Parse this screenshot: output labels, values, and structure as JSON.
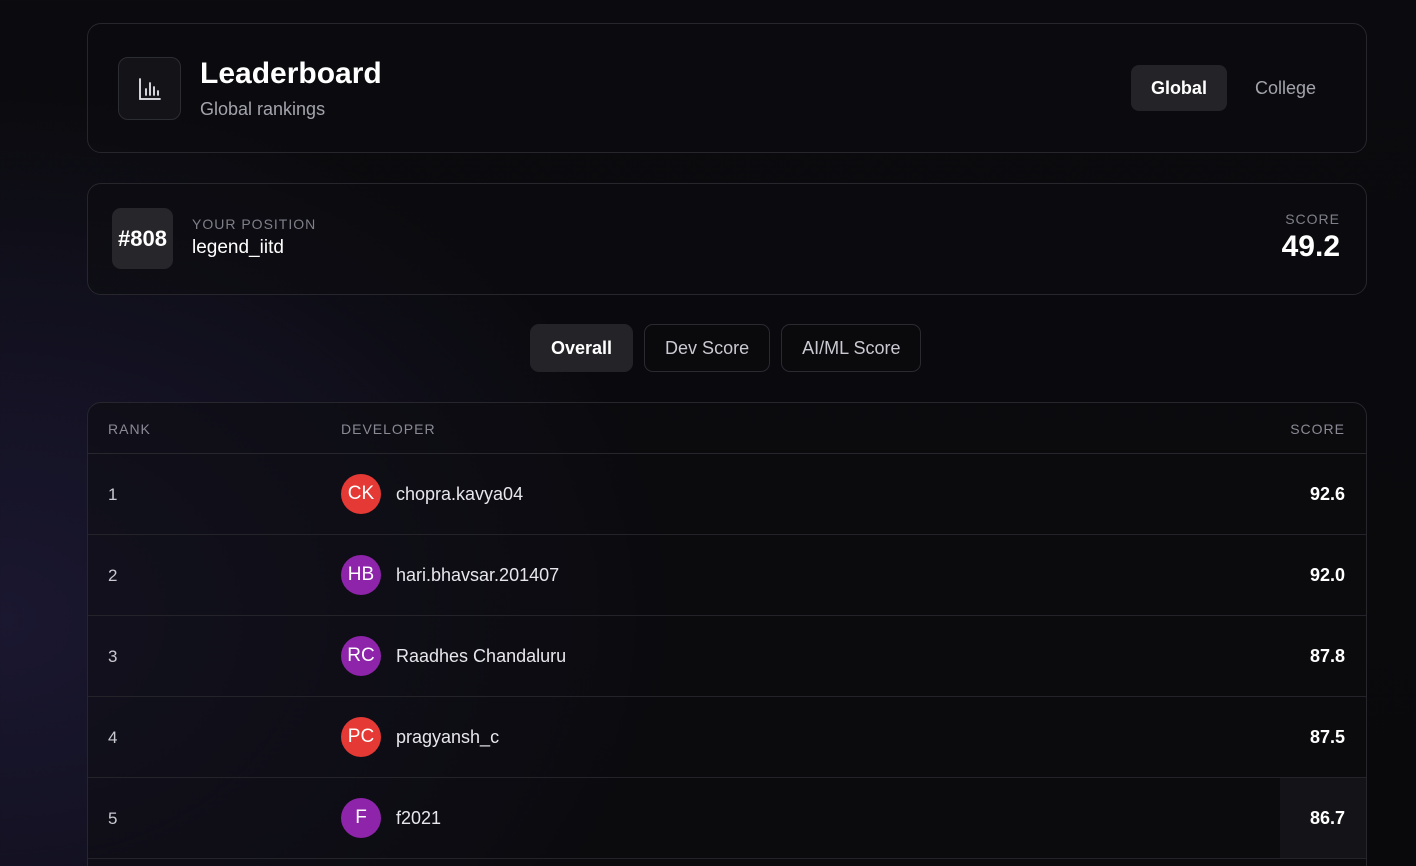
{
  "header": {
    "icon": "bar-chart-icon",
    "title": "Leaderboard",
    "subtitle": "Global rankings",
    "scope_options": [
      {
        "label": "Global",
        "active": true
      },
      {
        "label": "College",
        "active": false
      }
    ]
  },
  "position": {
    "rank": "#808",
    "label": "YOUR POSITION",
    "username": "legend_iitd",
    "score_label": "SCORE",
    "score": "49.2"
  },
  "tabs": [
    {
      "label": "Overall",
      "active": true
    },
    {
      "label": "Dev Score",
      "active": false
    },
    {
      "label": "AI/ML Score",
      "active": false
    }
  ],
  "table": {
    "columns": {
      "rank": "RANK",
      "developer": "DEVELOPER",
      "score": "SCORE"
    },
    "rows": [
      {
        "rank": "1",
        "initials": "CK",
        "avatar_color": "#e53935",
        "name": "chopra.kavya04",
        "score": "92.6"
      },
      {
        "rank": "2",
        "initials": "HB",
        "avatar_color": "#8e24aa",
        "name": "hari.bhavsar.201407",
        "score": "92.0"
      },
      {
        "rank": "3",
        "initials": "RC",
        "avatar_color": "#8e24aa",
        "name": "Raadhes Chandaluru",
        "score": "87.8"
      },
      {
        "rank": "4",
        "initials": "PC",
        "avatar_color": "#e53935",
        "name": "pragyansh_c",
        "score": "87.5"
      },
      {
        "rank": "5",
        "initials": "F",
        "avatar_color": "#8e24aa",
        "name": "f2021",
        "score": "86.7"
      }
    ]
  }
}
